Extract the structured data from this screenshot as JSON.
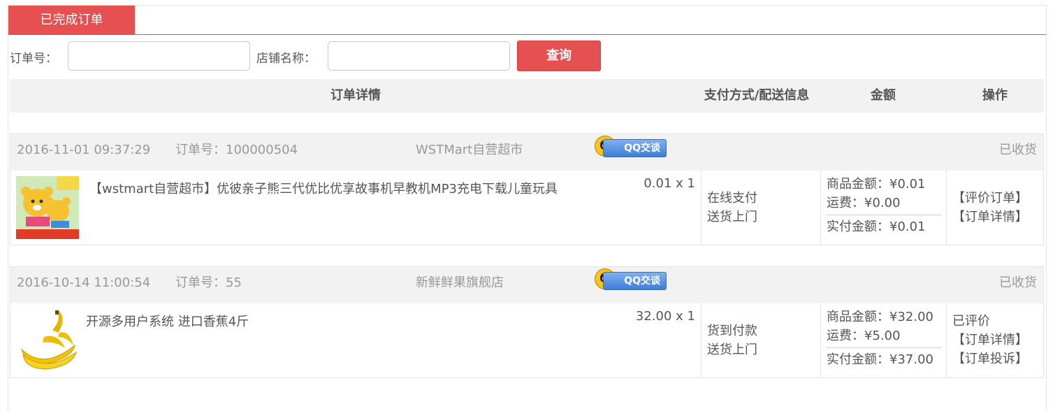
{
  "tab": {
    "label": "已完成订单"
  },
  "filters": {
    "order_no_label": "订单号：",
    "order_no_value": "",
    "shop_label": "店铺名称：",
    "shop_value": "",
    "search_button": "查询"
  },
  "table_header": {
    "detail": "订单详情",
    "payment": "支付方式/配送信息",
    "amount": "金额",
    "actions": "操作"
  },
  "orders": [
    {
      "time": "2016-11-01 09:37:29",
      "order_no": "订单号：100000504",
      "shop": "WSTMart自营超市",
      "qq_label": "QQ交谈",
      "status": "已收货",
      "goods_name": "【wstmart自营超市】优彼亲子熊三代优比优享故事机早教机MP3充电下载儿童玩具",
      "goods_icon": "bear-toy-icon",
      "qty": "0.01 x 1",
      "pay_method": "在线支付",
      "delivery": "送货上门",
      "goods_amount": "商品金额：¥0.01",
      "freight": "运费：¥0.00",
      "paid": "实付金额：¥0.01",
      "actions": [
        "【评价订单】",
        "【订单详情】"
      ]
    },
    {
      "time": "2016-10-14 11:00:54",
      "order_no": "订单号：55",
      "shop": "新鲜鲜果旗舰店",
      "qq_label": "QQ交谈",
      "status": "已收货",
      "goods_name": "开源多用户系统 进口香蕉4斤",
      "goods_icon": "banana-icon",
      "qty": "32.00 x 1",
      "pay_method": "货到付款",
      "delivery": "送货上门",
      "goods_amount": "商品金额：¥32.00",
      "freight": "运费：¥5.00",
      "paid": "实付金额：¥37.00",
      "actions": [
        "已评价",
        "【订单详情】",
        "【订单投诉】"
      ]
    }
  ],
  "colors": {
    "accent": "#e65050",
    "header_bg": "#f2f2f2",
    "muted_text": "#999999"
  }
}
